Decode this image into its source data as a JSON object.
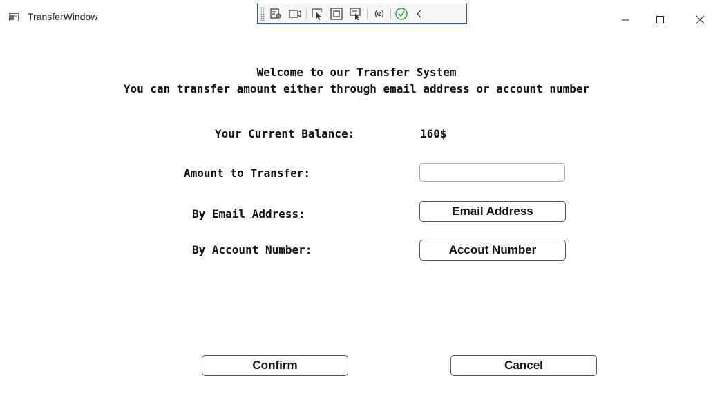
{
  "window": {
    "title": "TransferWindow"
  },
  "debug_toolbar": {
    "icons": [
      "live-visual-tree-icon",
      "live-preview-icon",
      "select-element-icon",
      "display-layout-adorners-icon",
      "track-focused-element-icon",
      "binding-failures-icon",
      "hot-reload-status-icon",
      "collapse-toolbar-icon"
    ]
  },
  "window_controls": {
    "icons": [
      "minimize-icon",
      "maximize-icon",
      "close-icon"
    ]
  },
  "header": {
    "line1": "Welcome to our Transfer System",
    "line2": "You can transfer amount either through email address or account number"
  },
  "balance": {
    "label": "Your Current Balance:",
    "value": "160$"
  },
  "amount": {
    "label": "Amount to Transfer:",
    "value": "",
    "placeholder": ""
  },
  "email": {
    "label": "By Email Address:",
    "button_label": "Email Address"
  },
  "account": {
    "label": "By Account Number:",
    "button_label": "Accout Number"
  },
  "actions": {
    "confirm_label": "Confirm",
    "cancel_label": "Cancel"
  },
  "colors": {
    "toolbar_border": "#2f52a8",
    "hot_reload_ok": "#2ca02c",
    "button_border": "#555555"
  }
}
